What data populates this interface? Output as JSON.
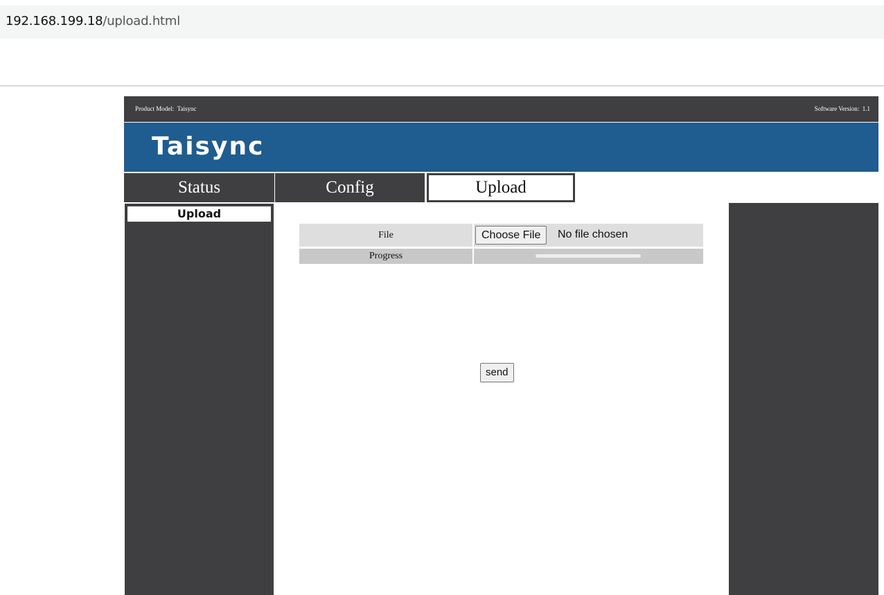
{
  "browser": {
    "url_host": "192.168.199.18",
    "url_path": "/upload.html"
  },
  "header": {
    "product_model": "Product Model:  Taisync",
    "software_version": "Software Version:  1.1",
    "brand": "Taisync"
  },
  "tabs": [
    {
      "label": "Status",
      "active": false
    },
    {
      "label": "Config",
      "active": false
    },
    {
      "label": "Upload",
      "active": true
    }
  ],
  "sidebar": {
    "items": [
      {
        "label": "Upload",
        "active": true
      }
    ]
  },
  "form": {
    "file_label": "File",
    "choose_file_button": "Choose File",
    "file_status": "No file chosen",
    "progress_label": "Progress",
    "progress_fraction": 0,
    "send_button": "send"
  },
  "colors": {
    "dark": "#3f3e40",
    "brand_blue": "#1f5c8f"
  }
}
